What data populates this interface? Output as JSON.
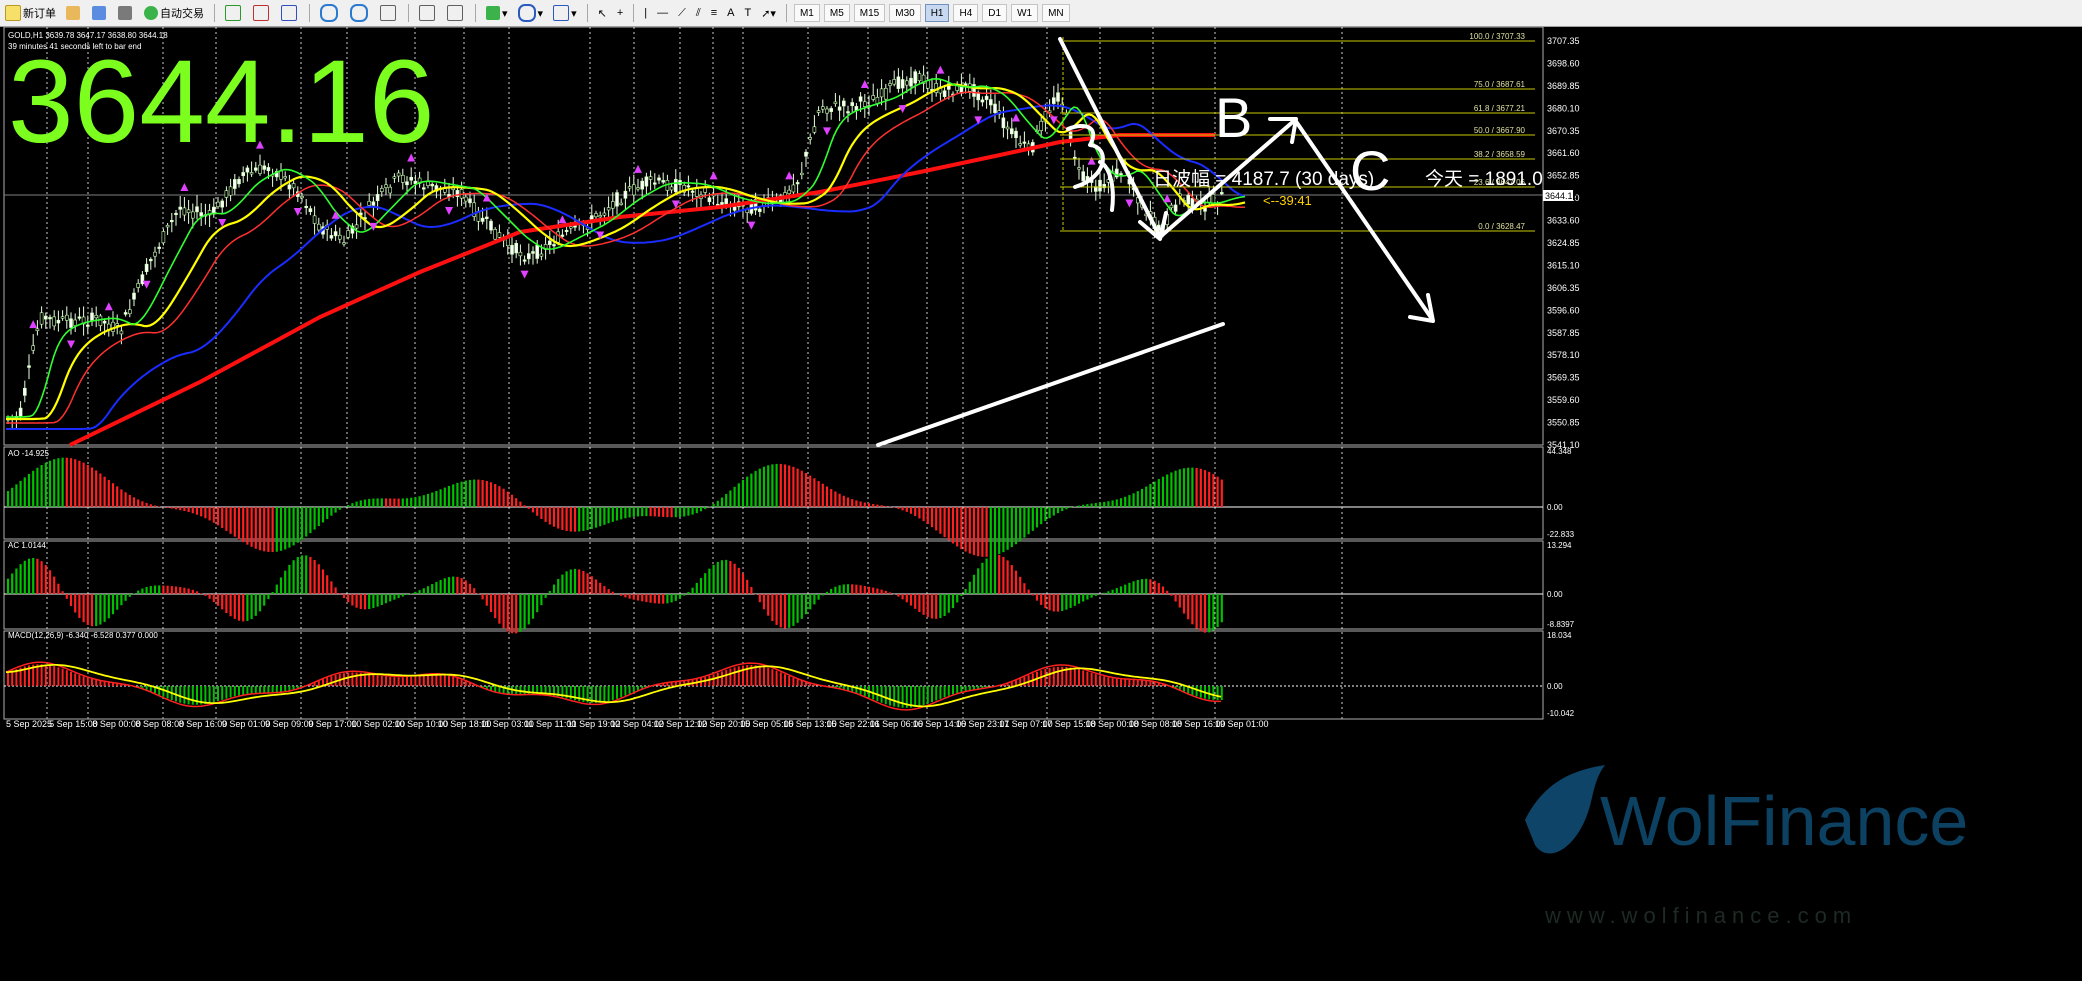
{
  "toolbar": {
    "new_order": "新订单",
    "auto_trading": "自动交易",
    "timeframes": [
      "M1",
      "M5",
      "M15",
      "M30",
      "H1",
      "H4",
      "D1",
      "W1",
      "MN"
    ],
    "active_timeframe": "H1"
  },
  "chart": {
    "symbol_line": "GOLD,H1  3639.78 3647.17 3638.80 3644.18",
    "countdown_line": "39 minutes 41 seconds left to bar end",
    "big_price": "3644.16",
    "timer_label": "<--39:41",
    "overlay_text_left": "日波幅 = 4187.7  (30 days)",
    "overlay_text_right": "今天 = 1891.0",
    "wave_labels": [
      "A",
      "B",
      "C"
    ],
    "price_axis": [
      "3707.35",
      "3698.60",
      "3689.85",
      "3680.10",
      "3670.35",
      "3661.60",
      "3652.85",
      "3644.10",
      "3633.60",
      "3624.85",
      "3615.10",
      "3606.35",
      "3596.60",
      "3587.85",
      "3578.10",
      "3569.35",
      "3559.60",
      "3550.85",
      "3541.10"
    ],
    "current_price_tag": "3644.16",
    "fib_levels": [
      {
        "label": "100.0 / 3707.33"
      },
      {
        "label": "75.0 / 3687.61"
      },
      {
        "label": "61.8 / 3677.21"
      },
      {
        "label": "50.0 / 3667.90"
      },
      {
        "label": "38.2 / 3658.59"
      },
      {
        "label": "23.6 / 3647.06"
      },
      {
        "label": "0.0 / 3628.47"
      }
    ],
    "time_axis": [
      "5 Sep 2025",
      "5 Sep 15:00",
      "8 Sep 00:00",
      "8 Sep 08:00",
      "8 Sep 16:00",
      "9 Sep 01:00",
      "9 Sep 09:00",
      "9 Sep 17:00",
      "10 Sep 02:00",
      "10 Sep 10:00",
      "10 Sep 18:00",
      "11 Sep 03:00",
      "11 Sep 11:00",
      "11 Sep 19:00",
      "12 Sep 04:00",
      "12 Sep 12:00",
      "12 Sep 20:00",
      "15 Sep 05:00",
      "15 Sep 13:00",
      "15 Sep 22:01",
      "16 Sep 06:00",
      "16 Sep 14:00",
      "16 Sep 23:01",
      "17 Sep 07:00",
      "17 Sep 15:00",
      "18 Sep 00:00",
      "18 Sep 08:00",
      "18 Sep 16:00",
      "19 Sep 01:00"
    ]
  },
  "indicators": {
    "ao": {
      "label": "AO -14.925",
      "axis": [
        "44.348",
        "0.00",
        "-22.833"
      ]
    },
    "ac": {
      "label": "AC 1.0144",
      "axis": [
        "13.294",
        "0.00",
        "-8.8397"
      ]
    },
    "macd": {
      "label": "MACD(12,26,9) -6.340 -6.528 0.377 0.000",
      "axis": [
        "18.034",
        "0.00",
        "-10.042"
      ]
    }
  },
  "watermark": {
    "brand": "WolFinance",
    "site": "www.wolfinance.com"
  },
  "colors": {
    "bull": "#00c000",
    "bear": "#ff2020",
    "ma_red": "#ff1010",
    "ma_blue": "#1a2cff",
    "ma_yellow": "#ffff00",
    "ma_green": "#30ff30",
    "big_price": "#7cff1e",
    "fib": "#c8c800"
  }
}
